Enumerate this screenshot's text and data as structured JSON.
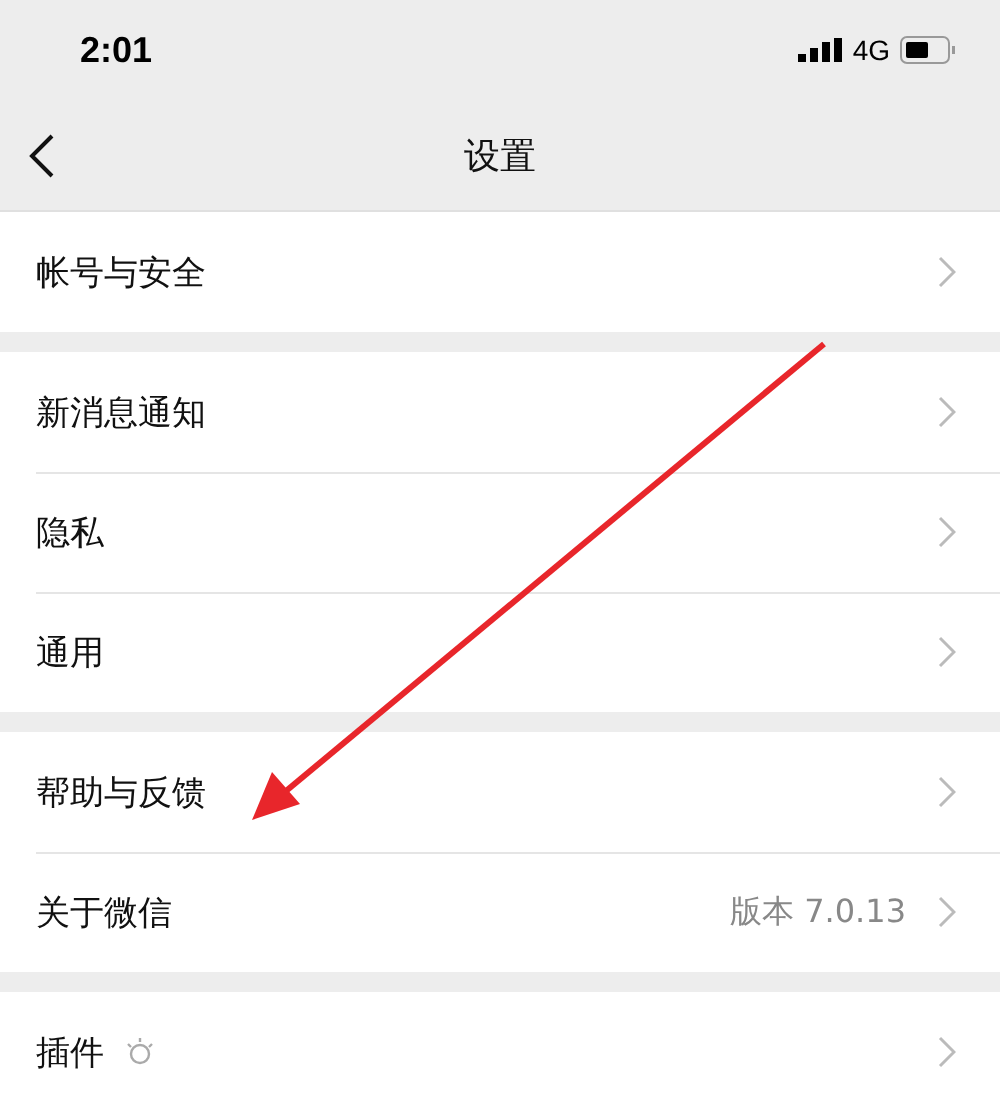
{
  "status_bar": {
    "time": "2:01",
    "network": "4G"
  },
  "nav": {
    "title": "设置"
  },
  "groups": [
    {
      "items": [
        {
          "label": "帐号与安全"
        }
      ]
    },
    {
      "items": [
        {
          "label": "新消息通知"
        },
        {
          "label": "隐私"
        },
        {
          "label": "通用"
        }
      ]
    },
    {
      "items": [
        {
          "label": "帮助与反馈"
        },
        {
          "label": "关于微信",
          "value": "版本 7.0.13"
        }
      ]
    },
    {
      "items": [
        {
          "label": "插件",
          "has_icon": true
        }
      ]
    }
  ]
}
